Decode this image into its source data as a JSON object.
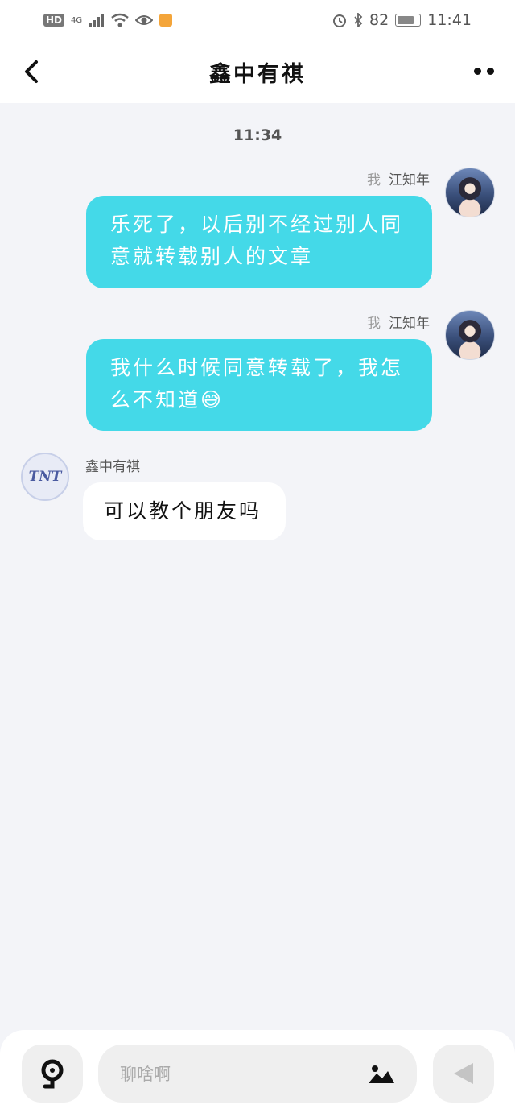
{
  "status_bar": {
    "hd": "HD",
    "network": "4G",
    "battery_percent": "82",
    "time": "11:41"
  },
  "header": {
    "title": "鑫中有祺"
  },
  "chat": {
    "timestamp": "11:34",
    "messages": [
      {
        "side": "right",
        "me_tag": "我",
        "sender": "江知年",
        "text": "乐死了，以后别不经过别人同意就转载别人的文章"
      },
      {
        "side": "right",
        "me_tag": "我",
        "sender": "江知年",
        "text": "我什么时候同意转载了，我怎么不知道😅"
      },
      {
        "side": "left",
        "sender": "鑫中有祺",
        "avatar_text": "TNT",
        "text": "可以教个朋友吗"
      }
    ]
  },
  "input": {
    "placeholder": "聊啥啊"
  },
  "colors": {
    "accent": "#44d9e8",
    "background": "#f3f4f8"
  },
  "icons": [
    "back-arrow-icon",
    "more-dots-icon",
    "voice-icon",
    "image-icon",
    "send-icon"
  ]
}
